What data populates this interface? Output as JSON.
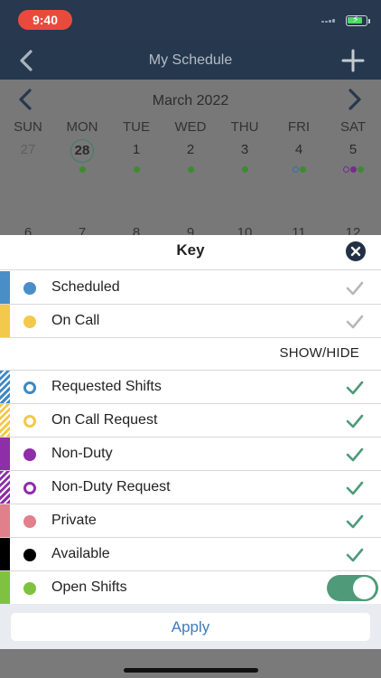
{
  "status_bar": {
    "time": "9:40"
  },
  "nav": {
    "title": "My Schedule"
  },
  "calendar": {
    "month": "March 2022",
    "days": [
      {
        "dow": "SUN",
        "date": "27",
        "muted": true,
        "today": false,
        "dots": []
      },
      {
        "dow": "MON",
        "date": "28",
        "muted": false,
        "today": true,
        "dots": [
          "green"
        ]
      },
      {
        "dow": "TUE",
        "date": "1",
        "muted": false,
        "today": false,
        "dots": [
          "green"
        ]
      },
      {
        "dow": "WED",
        "date": "2",
        "muted": false,
        "today": false,
        "dots": [
          "green"
        ]
      },
      {
        "dow": "THU",
        "date": "3",
        "muted": false,
        "today": false,
        "dots": [
          "green"
        ]
      },
      {
        "dow": "FRI",
        "date": "4",
        "muted": false,
        "today": false,
        "dots": [
          "ring-blue",
          "green"
        ]
      },
      {
        "dow": "SAT",
        "date": "5",
        "muted": false,
        "today": false,
        "dots": [
          "ring-purple",
          "purple",
          "green"
        ]
      }
    ],
    "next_week": [
      "6",
      "7",
      "8",
      "9",
      "10",
      "11",
      "12"
    ]
  },
  "key": {
    "title": "Key",
    "top_rows": [
      {
        "label": "Scheduled",
        "color": "#4a8ec8"
      },
      {
        "label": "On Call",
        "color": "#f2c94c"
      }
    ],
    "show_hide_label": "SHOW/HIDE",
    "rows": [
      {
        "label": "Requested Shifts",
        "color": "#3f88c5"
      },
      {
        "label": "On Call Request",
        "color": "#f2c94c"
      },
      {
        "label": "Non-Duty",
        "color": "#8e2ea8"
      },
      {
        "label": "Non-Duty Request",
        "color": "#8e2ea8"
      },
      {
        "label": "Private",
        "color": "#e17f8c"
      },
      {
        "label": "Available",
        "color": "#000000"
      },
      {
        "label": "Open Shifts",
        "color": "#7fc241"
      }
    ],
    "apply_label": "Apply"
  },
  "colors": {
    "accent_green": "#4e9a79",
    "check_gray": "#b8b8b8",
    "apply_blue": "#3a7bbf",
    "dot_green": "#3c8c2c",
    "dot_blue": "#2f6fad",
    "dot_purple": "#7a2a8f"
  },
  "icons": {
    "back": "chevron-left-icon",
    "add": "plus-icon",
    "prev_month": "chevron-left-icon",
    "next_month": "chevron-right-icon",
    "close": "close-icon",
    "check": "checkmark-icon"
  }
}
